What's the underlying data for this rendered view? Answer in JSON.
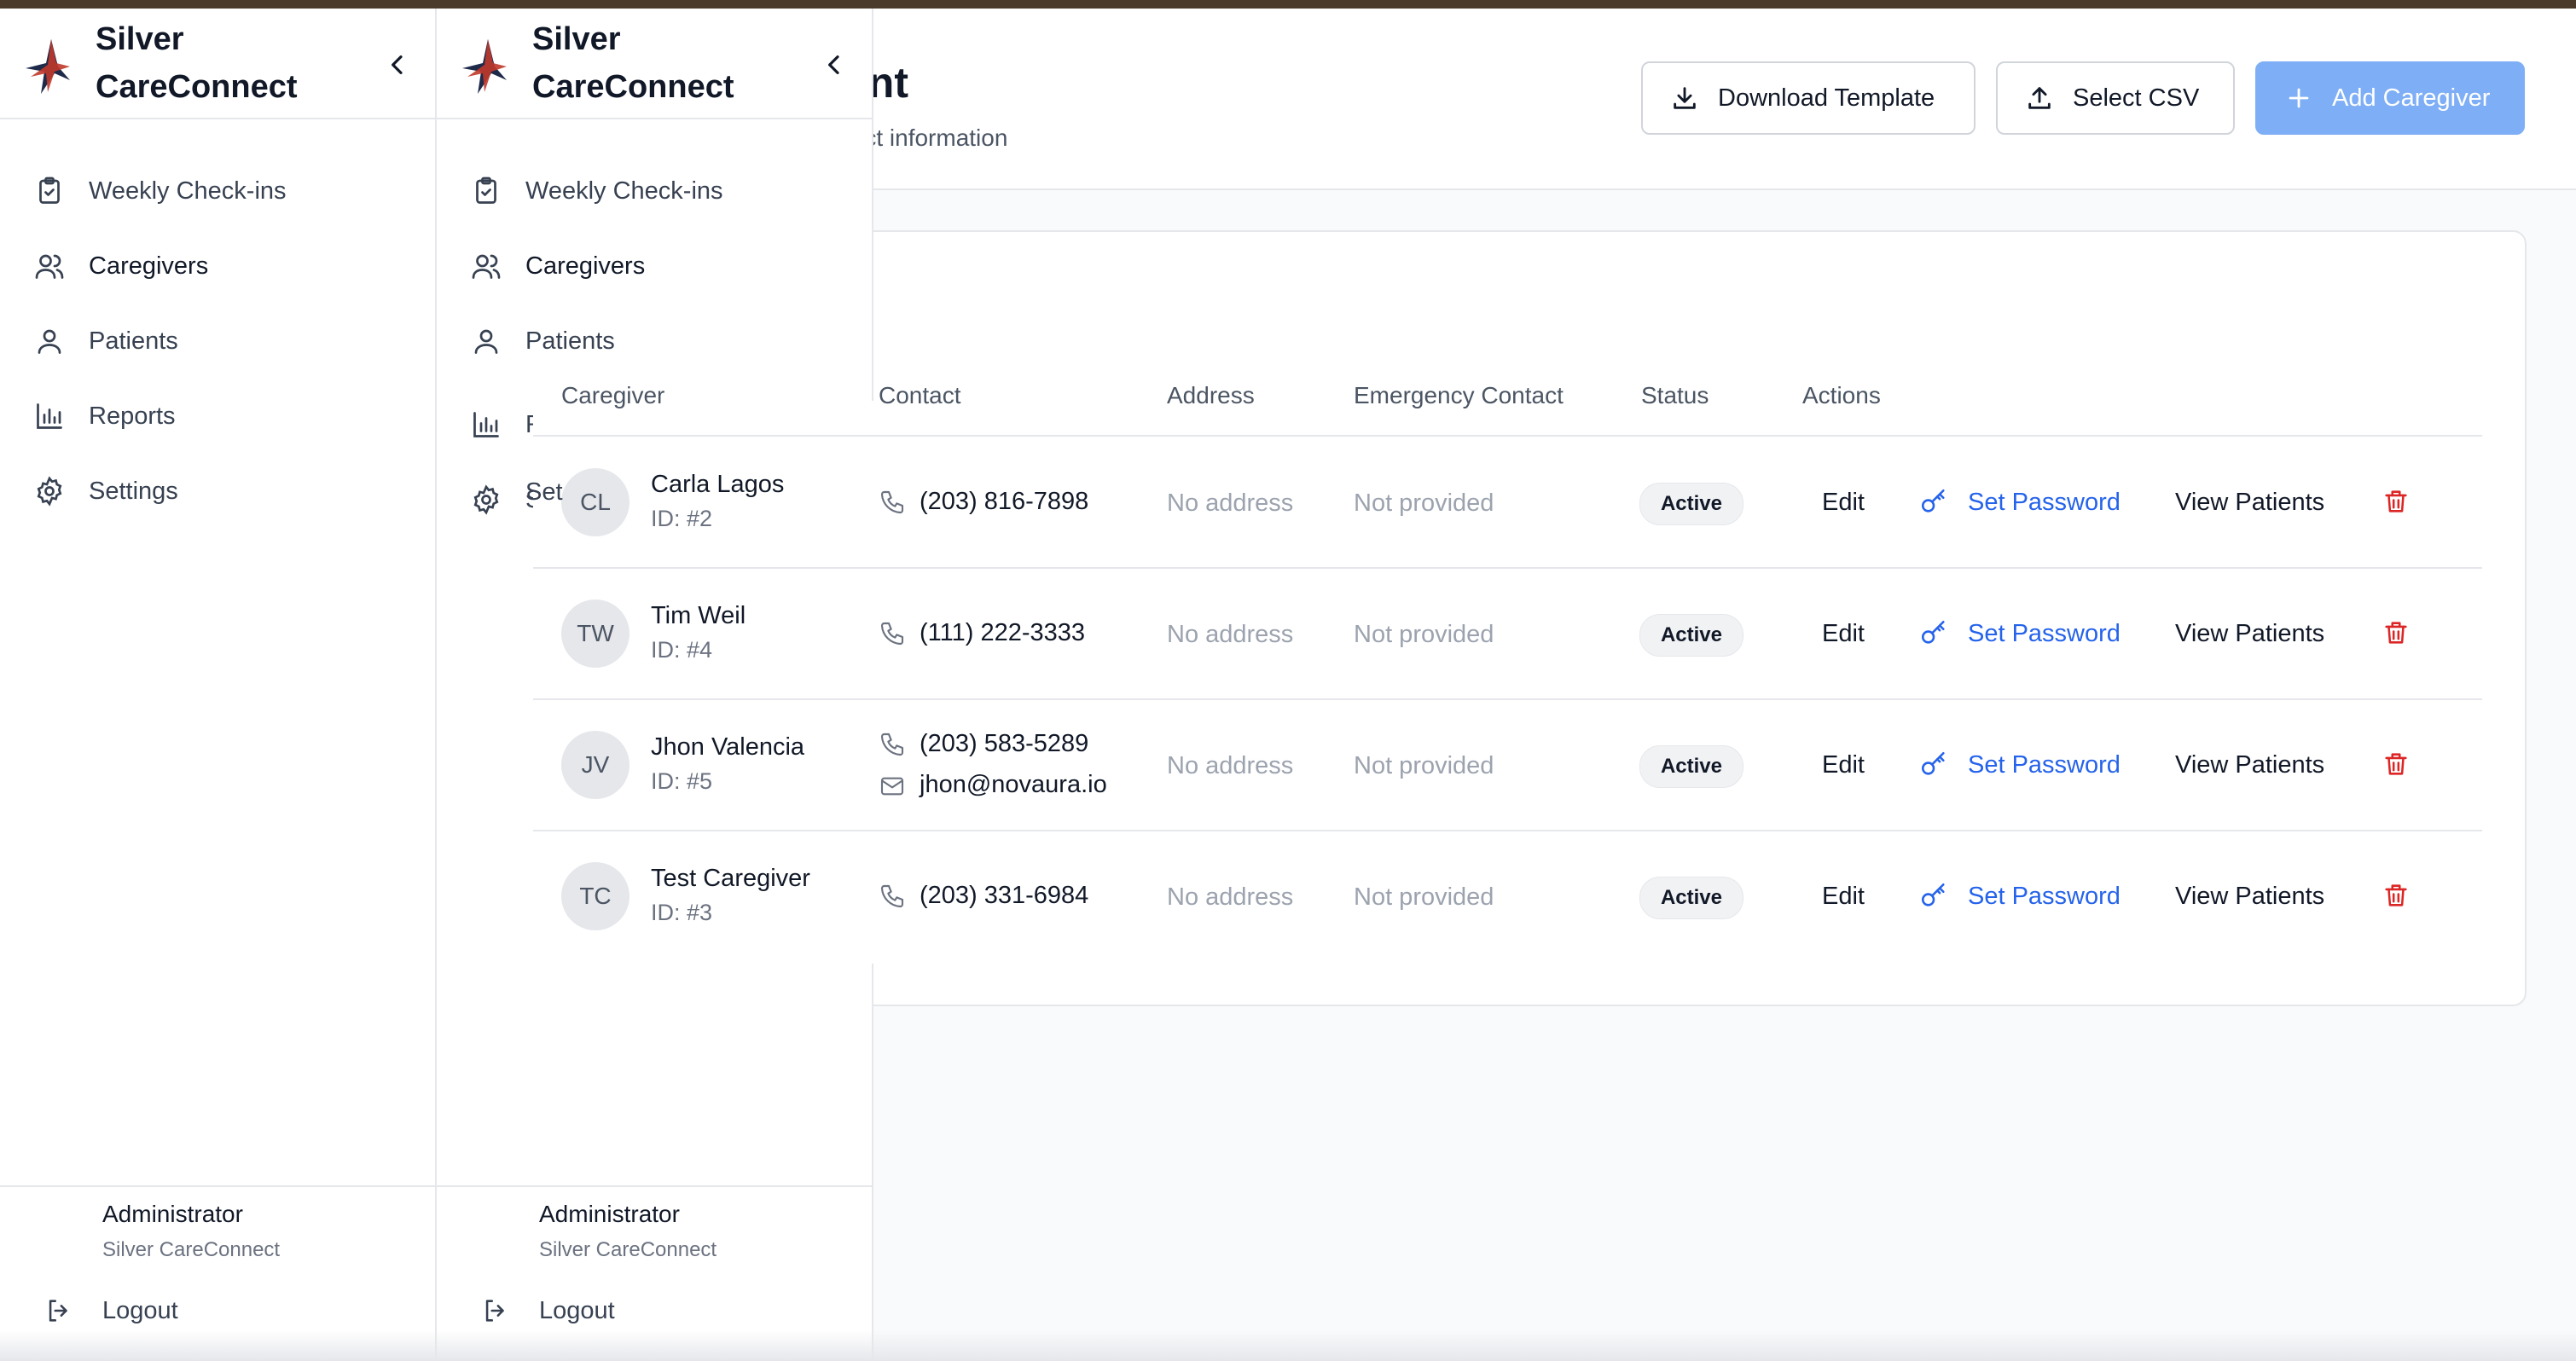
{
  "page": {
    "title": "ent",
    "subtitle": "tact information",
    "buttons": {
      "download": "Download Template",
      "csv": "Select CSV",
      "add": "Add Caregiver"
    }
  },
  "table": {
    "columns": {
      "caregiver": "Caregiver",
      "contact": "Contact",
      "address": "Address",
      "emergency": "Emergency Contact",
      "status": "Status",
      "actions": "Actions"
    },
    "rows": [
      {
        "initials": "CL",
        "name": "Carla Lagos",
        "id": "ID: #2",
        "phone": "(203) 816-7898",
        "email": "",
        "address": "No address",
        "emergency": "Not provided",
        "status": "Active",
        "edit": "Edit",
        "set_password": "Set Password",
        "view_patients": "View Patients"
      },
      {
        "initials": "TW",
        "name": "Tim Weil",
        "id": "ID: #4",
        "phone": "(111) 222-3333",
        "email": "",
        "address": "No address",
        "emergency": "Not provided",
        "status": "Active",
        "edit": "Edit",
        "set_password": "Set Password",
        "view_patients": "View Patients"
      },
      {
        "initials": "JV",
        "name": "Jhon Valencia",
        "id": "ID: #5",
        "phone": "(203) 583-5289",
        "email": "jhon@novaura.io",
        "address": "No address",
        "emergency": "Not provided",
        "status": "Active",
        "edit": "Edit",
        "set_password": "Set Password",
        "view_patients": "View Patients"
      },
      {
        "initials": "TC",
        "name": "Test Caregiver",
        "id": "ID: #3",
        "phone": "(203) 331-6984",
        "email": "",
        "address": "No address",
        "emergency": "Not provided",
        "status": "Active",
        "edit": "Edit",
        "set_password": "Set Password",
        "view_patients": "View Patients"
      }
    ]
  },
  "sidebar": {
    "brand_line1": "Silver",
    "brand_line2": "CareConnect",
    "items": [
      {
        "label": "Weekly Check-ins",
        "icon": "clipboard-check-icon"
      },
      {
        "label": "Caregivers",
        "icon": "users-icon"
      },
      {
        "label": "Patients",
        "icon": "user-icon"
      },
      {
        "label": "Reports",
        "icon": "bar-chart-icon"
      },
      {
        "label": "Settings",
        "icon": "gear-icon"
      }
    ],
    "settings_truncated": "Set",
    "user_name": "Administrator",
    "user_org": "Silver CareConnect",
    "logout": "Logout"
  },
  "colors": {
    "primary_button": "#7eaef5",
    "link": "#2563eb",
    "danger": "#dc2626",
    "brand_red": "#c0392b",
    "brand_navy": "#1e2a4a"
  }
}
